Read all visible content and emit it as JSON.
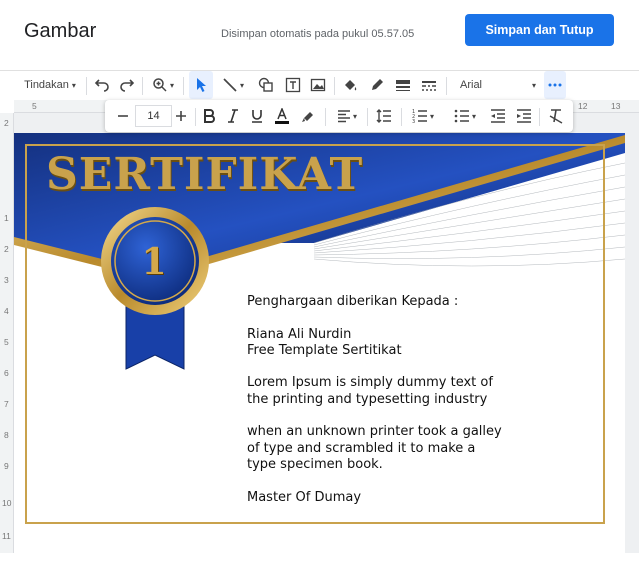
{
  "dialog": {
    "title": "Gambar",
    "autosave": "Disimpan otomatis pada pukul 05.57.05",
    "save_button": "Simpan dan Tutup"
  },
  "toolbar": {
    "actions_label": "Tindakan",
    "font": "Arial"
  },
  "format_bar": {
    "font_size": "14"
  },
  "ruler": {
    "top_left": "5",
    "top_right": [
      "12",
      "13"
    ],
    "left": [
      "2",
      "1",
      "2",
      "3",
      "4",
      "5",
      "6",
      "7",
      "8",
      "9",
      "10",
      "11"
    ]
  },
  "certificate": {
    "title": "SERTIFIKAT",
    "medal_number": "1",
    "lines": [
      "Penghargaan diberikan Kepada :",
      "",
      "Riana Ali Nurdin",
      "Free Template Sertitikat",
      "",
      "Lorem Ipsum is simply dummy text of",
      "the printing and typesetting industry",
      "",
      "when an unknown printer took a galley",
      "of type and scrambled it to make a",
      "type specimen book.",
      "",
      "Master Of Dumay"
    ]
  },
  "colors": {
    "accent": "#1a73e8",
    "cert_blue": "#1e3f9c",
    "cert_gold": "#c9a24c"
  }
}
